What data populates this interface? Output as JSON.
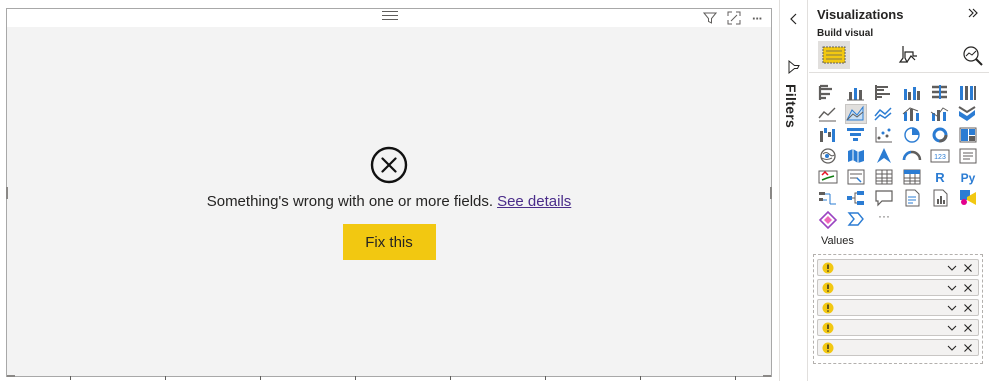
{
  "error": {
    "message": "Something's wrong with one or more fields.",
    "link_label": "See details",
    "fix_label": "Fix this"
  },
  "visual_header": {
    "icons": [
      "drag-handle-icon",
      "filter-icon",
      "focus-mode-icon",
      "more-options-icon"
    ],
    "more_glyph": "···"
  },
  "filters": {
    "label": "Filters",
    "icons": [
      "collapse-left-icon",
      "funnel-icon"
    ]
  },
  "visualizations": {
    "title": "Visualizations",
    "subtitle": "Build visual",
    "build_modes": [
      "build-visual-icon",
      "format-visual-icon",
      "analytics-icon"
    ],
    "active_build_mode": 0,
    "selected_visual_index": 7,
    "visual_types": [
      "stacked-bar-chart",
      "stacked-column-chart",
      "clustered-bar-chart",
      "clustered-column-chart",
      "100-stacked-bar-chart",
      "100-stacked-column-chart",
      "line-chart",
      "area-chart",
      "stacked-area-chart",
      "line-and-stacked-column-chart",
      "line-and-clustered-column-chart",
      "ribbon-chart",
      "waterfall-chart",
      "funnel-chart",
      "scatter-chart",
      "pie-chart",
      "donut-chart",
      "treemap",
      "map",
      "filled-map",
      "azure-map",
      "gauge",
      "card",
      "multi-row-card",
      "kpi",
      "slicer",
      "table",
      "matrix",
      "r-script-visual",
      "python-visual",
      "key-influencers",
      "decomposition-tree",
      "qa",
      "smart-narrative",
      "paginated-report",
      "power-apps",
      "power-automate",
      "get-more-visuals",
      "more-visuals"
    ],
    "r_label": "R",
    "py_label": "Py",
    "more_glyph": "···"
  },
  "values": {
    "label": "Values",
    "fields": [
      {
        "status": "warning"
      },
      {
        "status": "warning"
      },
      {
        "status": "warning"
      },
      {
        "status": "warning"
      },
      {
        "status": "warning"
      }
    ]
  },
  "colors": {
    "accent": "#f2c811",
    "link": "#4a2c8a",
    "warning": "#f2c811",
    "icon_blue": "#2b7cd3",
    "icon_gray": "#605e5c"
  }
}
